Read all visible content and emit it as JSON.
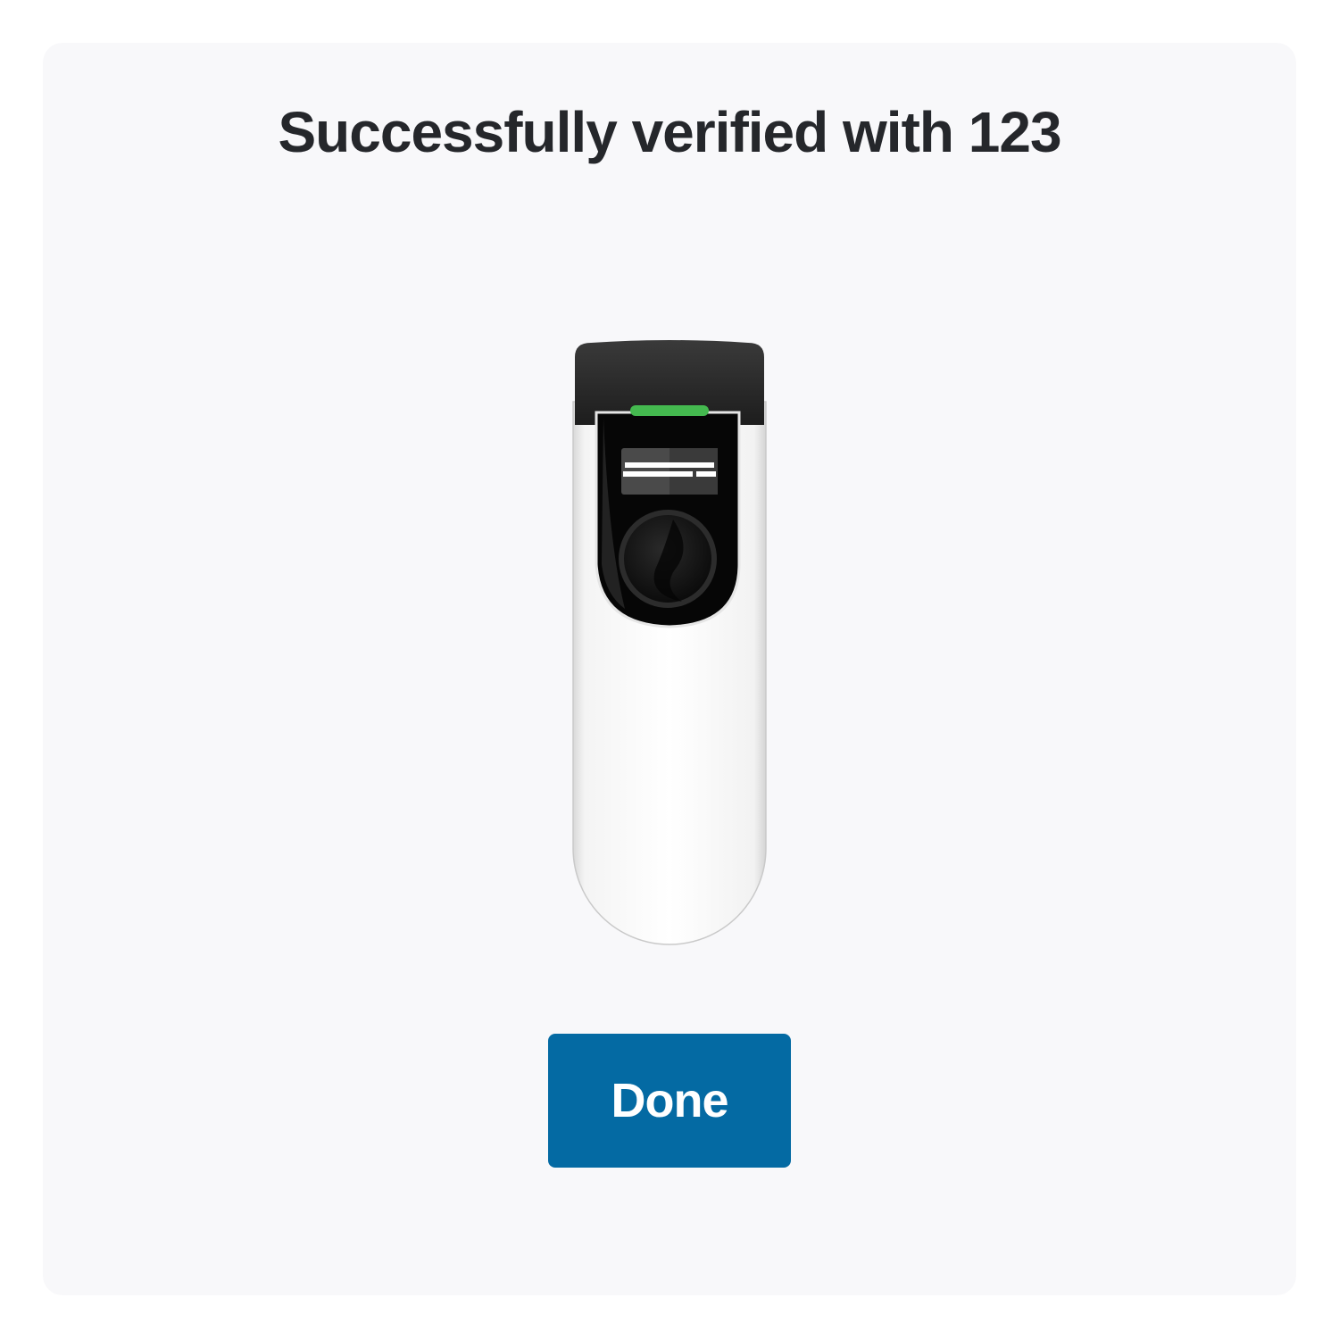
{
  "page": {
    "title": "Successfully verified with 123"
  },
  "device": {
    "icon": "ev-charger-icon",
    "status_light_color": "#44b94f"
  },
  "actions": {
    "done_label": "Done"
  },
  "colors": {
    "primary": "#046aa3",
    "card_background": "#f8f8fa",
    "title_text": "#25272b"
  }
}
